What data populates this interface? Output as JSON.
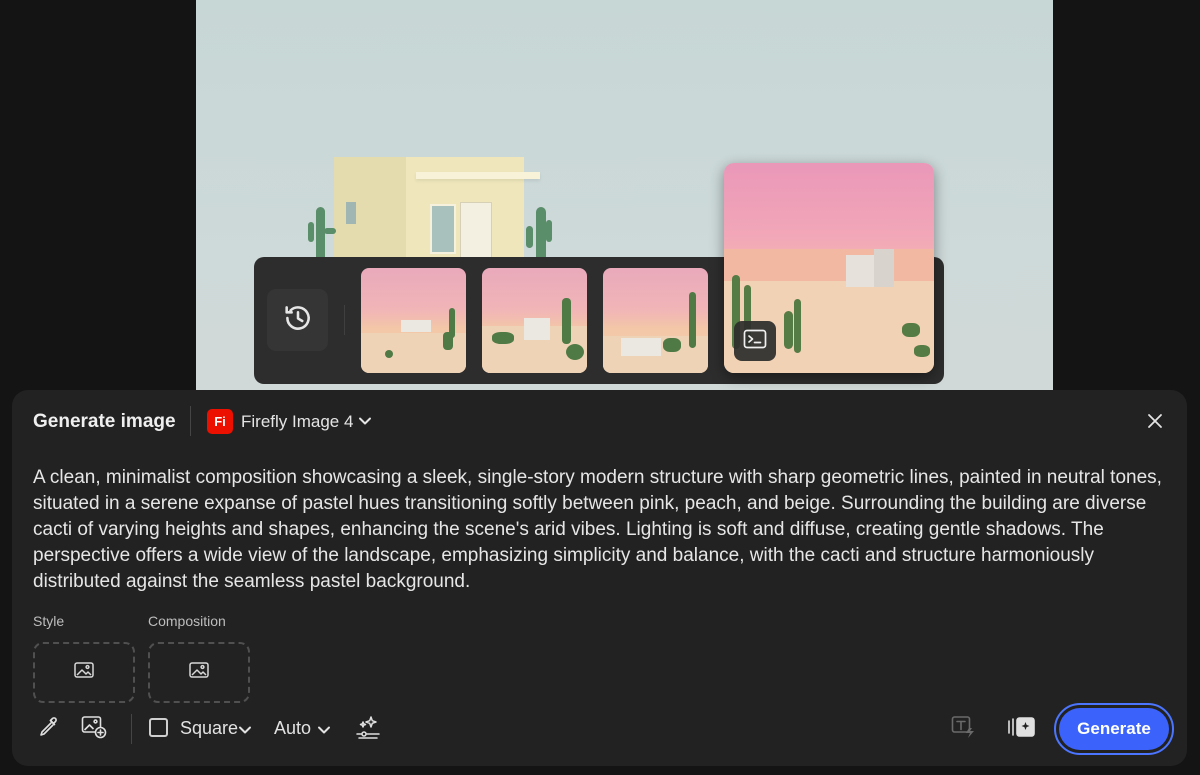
{
  "panel": {
    "title": "Generate image",
    "model_badge": "Fi",
    "model_name": "Firefly Image 4",
    "prompt_text": "A clean, minimalist composition showcasing a sleek, single-story modern structure with sharp geometric lines, painted in neutral tones, situated in a serene expanse of pastel hues transitioning softly between pink, peach, and beige. Surrounding the building are diverse cacti of varying heights and shapes, enhancing the scene's arid vibes. Lighting is soft and diffuse, creating gentle shadows. The perspective offers a wide view of the landscape, emphasizing simplicity and balance, with the cacti and structure harmoniously distributed against the seamless pastel background.",
    "style_label": "Style",
    "composition_label": "Composition"
  },
  "toolbar": {
    "aspect_label": "Square",
    "auto_label": "Auto",
    "generate_label": "Generate"
  },
  "colors": {
    "accent": "#3b63fb",
    "model_badge": "#eb1000",
    "panel_bg": "#222222"
  },
  "icons": [
    "history-icon",
    "prompt-terminal-icon",
    "close-icon",
    "chevron-down-icon",
    "image-icon",
    "eyedropper-icon",
    "image-add-icon",
    "effects-sparkle-icon",
    "text-effect-icon",
    "variations-icon"
  ]
}
